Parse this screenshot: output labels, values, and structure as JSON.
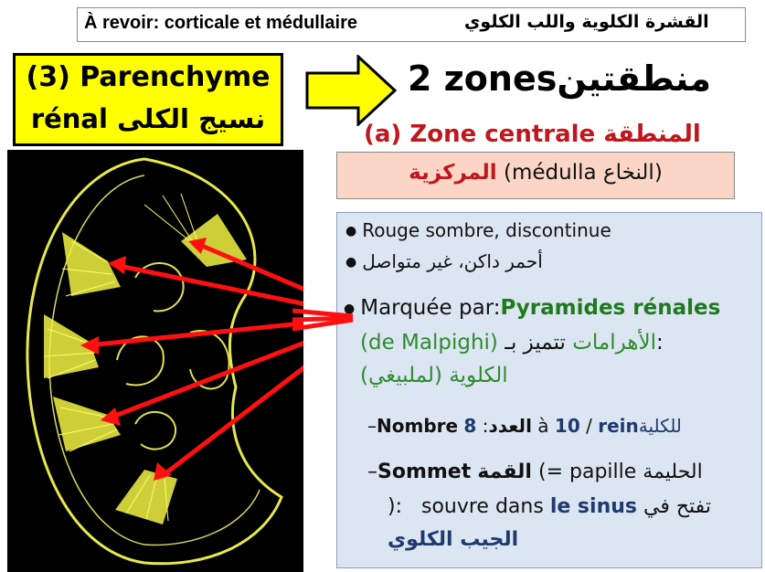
{
  "review": {
    "fr": "À revoir: corticale et médullaire",
    "ar": "القشرة الكلوية واللب الكلوي"
  },
  "parenchyme": {
    "number": "(3)",
    "fr_title": "Parenchyme",
    "fr_rest": "rénal",
    "ar": "نسيج الكلى"
  },
  "zones": {
    "count_label": "2 zones",
    "ar": "منطقتين"
  },
  "zone_central": {
    "label_fr": "(a) Zone centrale",
    "label_ar": "المنطقة"
  },
  "medulla": {
    "ar_bold": "المركزية",
    "fr": "(médulla",
    "ar_paren": "النخاع)"
  },
  "details": {
    "rouge": "Rouge sombre, discontinue",
    "ahmar": "أحمر داكن، غير متواصل",
    "marquee_prefix": "Marquée par:",
    "pyramides": "Pyramides rénales",
    "malpighi": "(de Malpighi)",
    "ahramat": "الأهرامات",
    "tamayaz": "تتميز بـ:",
    "kulawiya": "الكلوية (لملبيغي)",
    "nombre_label": "Nombre",
    "adad": "العدد",
    "nombre_range_1": "8",
    "nombre_a": "à",
    "nombre_range_2": "10",
    "slash": "/",
    "rein": "rein",
    "lilkulya": "للكلية",
    "sommet_label": "Sommet",
    "qimma": "القمة",
    "papille_eq": "(= papille",
    "halima": "الحليمة",
    "souvre_colon": "):",
    "souvre": "souvre dans",
    "sinus": "le sinus",
    "tuftah": "تفتح في",
    "jayb": "الجيب الكلوي"
  },
  "colors": {
    "yellow": "#ffff00",
    "red": "#c0171e",
    "green": "#2e8b2e",
    "navy": "#1f3a6e",
    "medulla_bg": "#fbd6c6",
    "details_bg": "#dce6f2"
  }
}
